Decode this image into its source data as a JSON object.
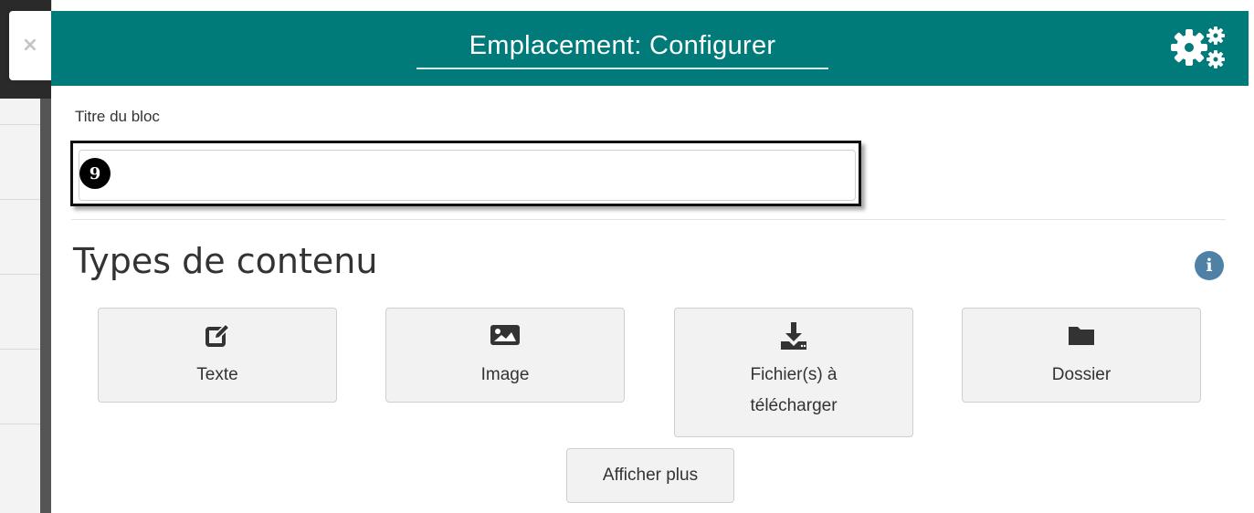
{
  "close_tab": {
    "label": "×"
  },
  "header": {
    "title": "Emplacement: Configurer",
    "icon": "gears-icon",
    "bg_color": "#017a7a"
  },
  "form": {
    "label": "Titre du bloc",
    "value": "",
    "placeholder": "",
    "step_badge": "9"
  },
  "content_types": {
    "title": "Types de contenu",
    "info_icon": "i",
    "items": [
      {
        "label": "Texte",
        "icon": "edit-icon"
      },
      {
        "label": "Image",
        "icon": "image-icon"
      },
      {
        "label": "Fichier(s) à télécharger",
        "icon": "download-icon"
      },
      {
        "label": "Dossier",
        "icon": "folder-icon"
      }
    ],
    "show_more": "Afficher plus"
  }
}
